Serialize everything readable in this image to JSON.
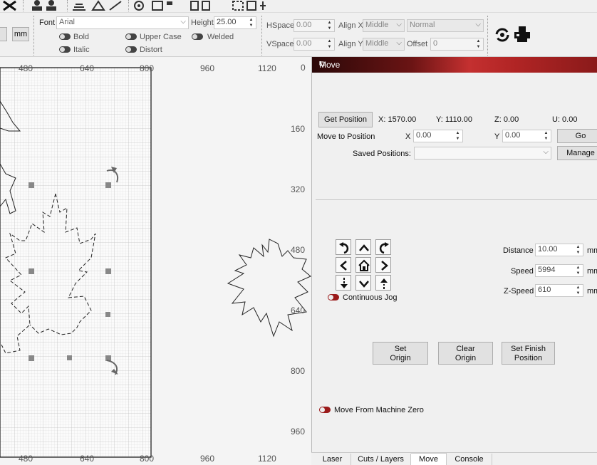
{
  "toolbar": {
    "mm_label": "mm",
    "font_label": "Font",
    "font_value": "Arial",
    "height_label": "Height",
    "height_value": "25.00",
    "hspace_label": "HSpace",
    "hspace_value": "0.00",
    "vspace_label": "VSpace",
    "vspace_value": "0.00",
    "align_x_label": "Align X",
    "align_x_value": "Middle",
    "align_y_label": "Align Y",
    "align_y_value": "Middle",
    "normal_value": "Normal",
    "offset_label": "Offset",
    "offset_value": "0",
    "bold_label": "Bold",
    "italic_label": "Italic",
    "upper_case_label": "Upper Case",
    "distort_label": "Distort",
    "welded_label": "Welded"
  },
  "canvas": {
    "top_ruler": [
      "480",
      "640",
      "800",
      "960",
      "1120"
    ],
    "bottom_ruler": [
      "480",
      "640",
      "800",
      "960",
      "1120"
    ],
    "right_ruler": [
      "0",
      "160",
      "320",
      "480",
      "640",
      "800",
      "960"
    ]
  },
  "move_panel": {
    "title": "Move",
    "get_position": "Get Position",
    "x_readout": "X: 1570.00",
    "y_readout": "Y: 1110.00",
    "z_readout": "Z: 0.00",
    "u_readout": "U: 0.00",
    "move_to_position": "Move to Position",
    "x_label": "X",
    "x_value": "0.00",
    "y_label": "Y",
    "y_value": "0.00",
    "go": "Go",
    "saved_positions": "Saved Positions:",
    "manage": "Manage",
    "distance_label": "Distance",
    "distance_value": "10.00",
    "distance_unit": "mm",
    "speed_label": "Speed",
    "speed_value": "5994",
    "speed_unit": "mm",
    "zspeed_label": "Z-Speed",
    "zspeed_value": "610",
    "zspeed_unit": "mm",
    "continuous_jog": "Continuous Jog",
    "set_origin_1": "Set",
    "set_origin_2": "Origin",
    "clear_origin_1": "Clear",
    "clear_origin_2": "Origin",
    "set_finish_1": "Set Finish",
    "set_finish_2": "Position",
    "move_from_machine_zero": "Move From Machine Zero"
  },
  "tabs": [
    "Laser",
    "Cuts / Layers",
    "Move",
    "Console"
  ],
  "active_tab": "Move",
  "colors": {
    "title_accent": "#c43030",
    "toggle_on": "#9b1b1b"
  }
}
